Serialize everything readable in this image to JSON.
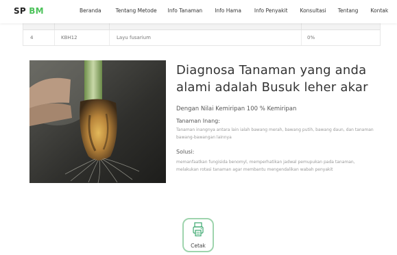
{
  "brand": {
    "part1": "SP",
    "part2": "BM"
  },
  "nav": {
    "items": [
      "Beranda",
      "Tentang Metode",
      "Info Tanaman",
      "Info Hama",
      "Info Penyakit",
      "Konsultasi",
      "Tentang",
      "Kontak"
    ]
  },
  "table": {
    "row": {
      "no": "4",
      "code": "KBH12",
      "name": "Layu fusarium",
      "value": "0%"
    }
  },
  "result": {
    "title": "Diagnosa Tanaman yang anda alami adalah Busuk leher akar",
    "similarity": "Dengan Nilai Kemiripan 100 % Kemiripan",
    "host_label": "Tanaman Inang:",
    "host_text": "Tanaman inangnya antara lain ialah bawang merah, bawang putih, bawang daun, dan tanaman bawang-bawangan lainnya",
    "solution_label": "Solusi:",
    "solution_text": "memanfaatkan fungisida benomyl, memperhatikan jadwal pemupukan pada tanaman, melakukan rotasi tanaman agar membantu mengendalikan wabah penyakit"
  },
  "print": {
    "label": "Cetak"
  },
  "colors": {
    "brand_accent": "#4cc25a",
    "button_border": "#9ed4ad"
  }
}
